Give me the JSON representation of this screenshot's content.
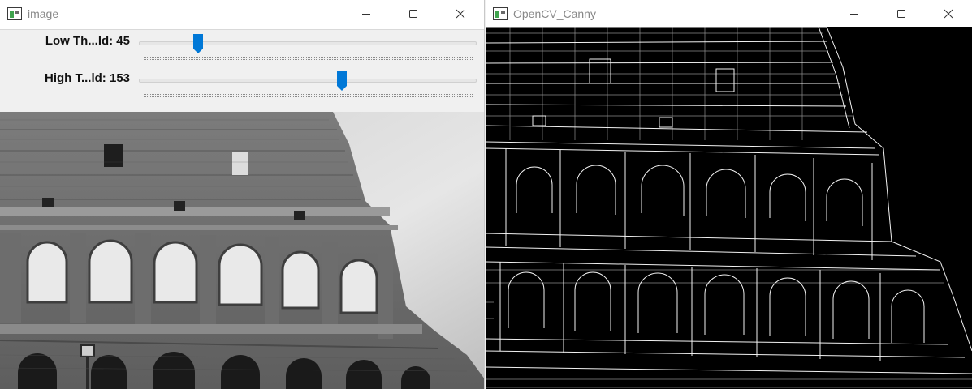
{
  "image_window": {
    "title": "image",
    "trackbars": [
      {
        "label": "Low Th...ld: 45",
        "value": 45,
        "max": 255
      },
      {
        "label": "High T...ld: 153",
        "value": 153,
        "max": 255
      }
    ]
  },
  "canny_window": {
    "title": "OpenCV_Canny"
  },
  "colors": {
    "thumb": "#0078d7",
    "title_text": "#888888"
  }
}
